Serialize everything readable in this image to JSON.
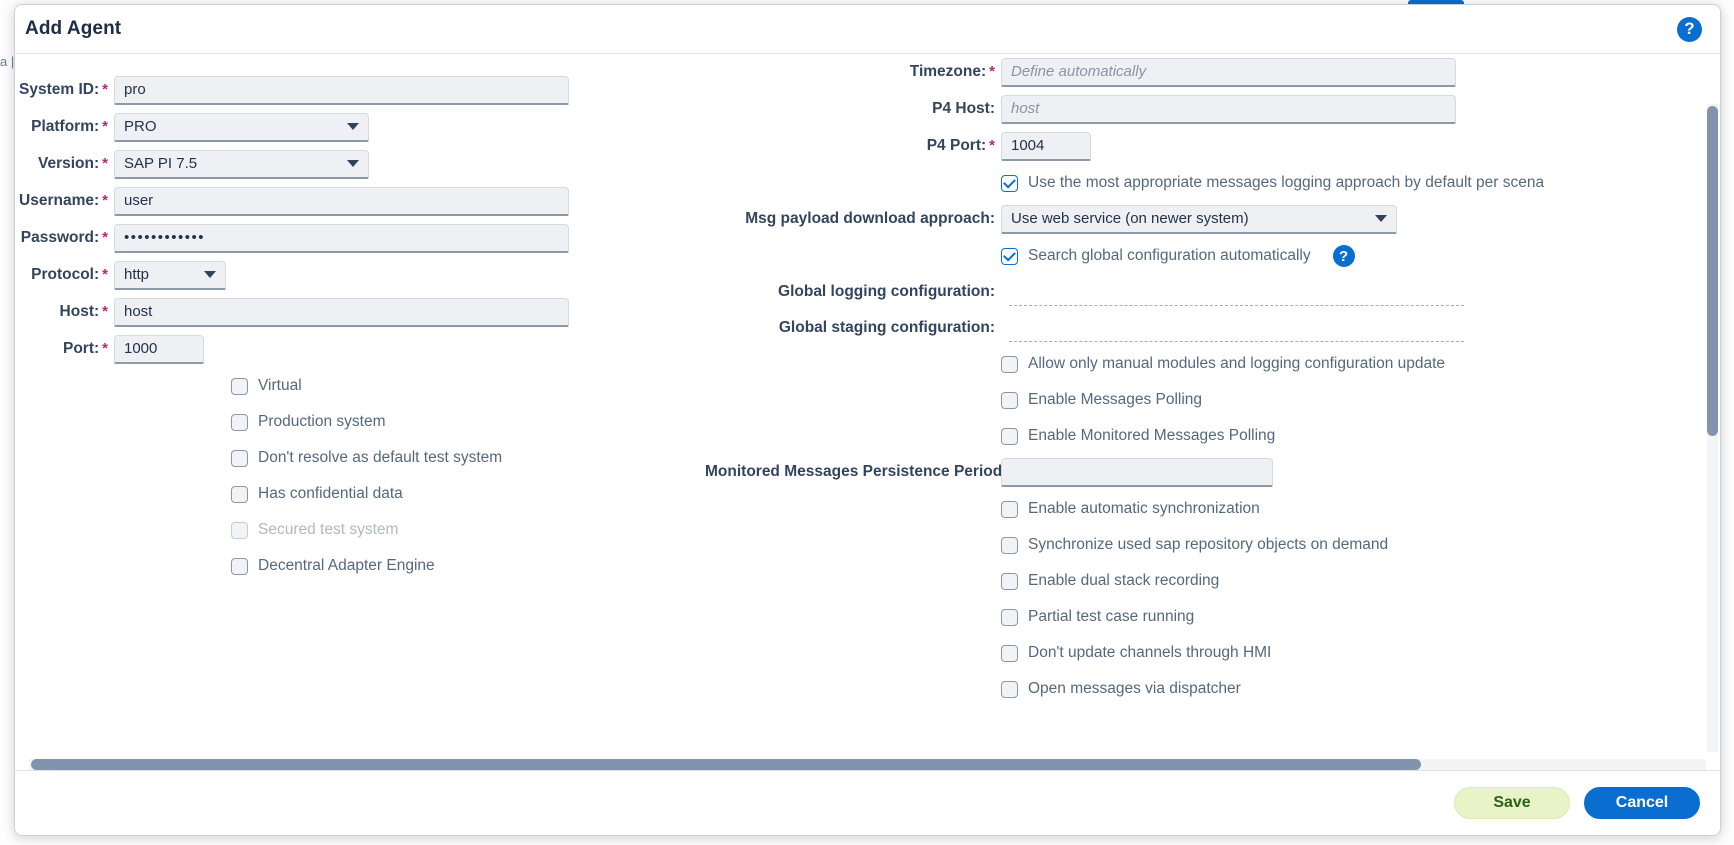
{
  "window": {
    "title": "Add Agent",
    "help_icon": "help-circle-icon"
  },
  "left_form": {
    "fields": [
      {
        "label": "System ID:",
        "required": true,
        "value": "pro",
        "type": "text"
      },
      {
        "label": "Platform:",
        "required": true,
        "value": "PRO",
        "type": "select"
      },
      {
        "label": "Version:",
        "required": true,
        "value": "SAP PI 7.5",
        "type": "select"
      },
      {
        "label": "Username:",
        "required": true,
        "value": "user",
        "type": "text"
      },
      {
        "label": "Password:",
        "required": true,
        "value": "••••••••••••",
        "type": "password"
      },
      {
        "label": "Protocol:",
        "required": true,
        "value": "http",
        "type": "select"
      },
      {
        "label": "Host:",
        "required": true,
        "value": "host",
        "type": "text"
      },
      {
        "label": "Port:",
        "required": true,
        "value": "1000",
        "type": "number"
      }
    ],
    "checkboxes": [
      {
        "label": "Virtual",
        "checked": false,
        "disabled": false
      },
      {
        "label": "Production system",
        "checked": false,
        "disabled": false
      },
      {
        "label": "Don't resolve as default test system",
        "checked": false,
        "disabled": false
      },
      {
        "label": "Has confidential data",
        "checked": false,
        "disabled": false
      },
      {
        "label": "Secured test system",
        "checked": false,
        "disabled": true
      },
      {
        "label": "Decentral Adapter Engine",
        "checked": false,
        "disabled": false
      }
    ]
  },
  "right_form": {
    "timezone": {
      "label": "Timezone:",
      "required": true,
      "placeholder": "Define automatically",
      "value": ""
    },
    "p4_host": {
      "label": "P4 Host:",
      "required": false,
      "placeholder": "host",
      "value": ""
    },
    "p4_port": {
      "label": "P4 Port:",
      "required": true,
      "value": "1004"
    },
    "logging_default": {
      "label": "Use the most appropriate messages logging approach by default per scena",
      "checked": true
    },
    "msg_payload": {
      "label": "Msg payload download approach:",
      "value": "Use web service (on newer system)"
    },
    "search_global": {
      "label": "Search global configuration automatically",
      "checked": true,
      "help_icon": "help-circle-icon"
    },
    "global_logging": {
      "label": "Global logging configuration:"
    },
    "global_staging": {
      "label": "Global staging configuration:"
    },
    "persistence": {
      "label": "Monitored Messages Persistence Period:",
      "value": ""
    },
    "checkboxes_a": [
      {
        "label": "Allow only manual modules and logging configuration update",
        "checked": false
      },
      {
        "label": "Enable Messages Polling",
        "checked": false
      },
      {
        "label": "Enable Monitored Messages Polling",
        "checked": false
      }
    ],
    "checkboxes_b": [
      {
        "label": "Enable automatic synchronization",
        "checked": false
      },
      {
        "label": "Synchronize used sap repository objects on demand",
        "checked": false
      },
      {
        "label": "Enable dual stack recording",
        "checked": false
      },
      {
        "label": "Partial test case running",
        "checked": false
      },
      {
        "label": "Don't update channels through HMI",
        "checked": false
      },
      {
        "label": "Open messages via dispatcher",
        "checked": false
      }
    ]
  },
  "footer": {
    "save_label": "Save",
    "cancel_label": "Cancel"
  },
  "colors": {
    "accent_blue": "#0a6ed1",
    "required_mark": "#b5257a",
    "save_bg": "#e8f3c8",
    "save_text": "#2c6115",
    "label_text": "#33455e",
    "field_bg": "#eef0f4",
    "scrollbar": "#8294ad"
  }
}
